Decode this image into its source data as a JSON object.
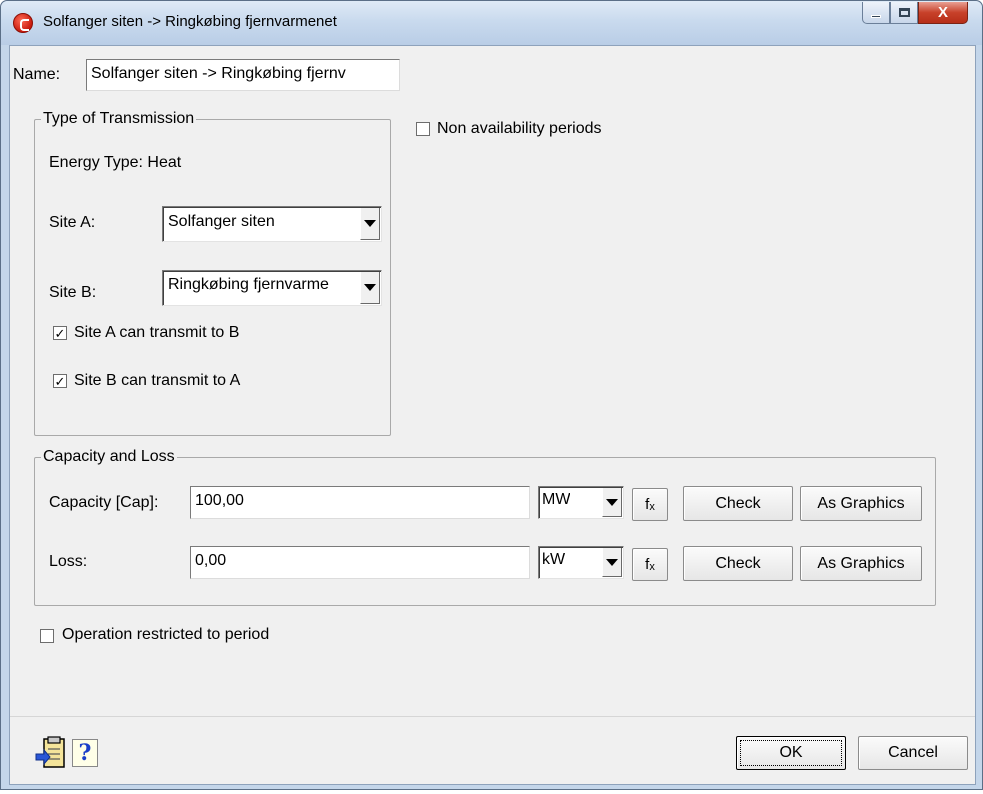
{
  "window": {
    "title": "Solfanger siten -> Ringkøbing fjernvarmenet",
    "controls": {
      "minimize": "minimize",
      "maximize": "maximize",
      "close": "X"
    }
  },
  "name": {
    "label": "Name:",
    "value": "Solfanger siten -> Ringkøbing fjernv"
  },
  "transmission": {
    "legend": "Type of Transmission",
    "energy_type": "Energy Type: Heat",
    "site_a_label": "Site A:",
    "site_a_value": "Solfanger siten",
    "site_b_label": "Site B:",
    "site_b_value": "Ringkøbing fjernvarme",
    "a_to_b_label": "Site A can transmit to B",
    "a_to_b_checked": true,
    "b_to_a_label": "Site B can transmit to A",
    "b_to_a_checked": true
  },
  "non_availability": {
    "label": "Non availability periods",
    "checked": false
  },
  "capacity_loss": {
    "legend": "Capacity and Loss",
    "capacity_label": "Capacity [Cap]:",
    "capacity_value": "100,00",
    "capacity_unit": "MW",
    "loss_label": "Loss:",
    "loss_value": "0,00",
    "loss_unit": "kW",
    "fx_label": "f",
    "fx_sub": "x",
    "check_label": "Check",
    "graphics_label": "As Graphics"
  },
  "operation_restricted": {
    "label": "Operation restricted to period",
    "checked": false
  },
  "footer": {
    "help_glyph": "?",
    "ok_label": "OK",
    "cancel_label": "Cancel"
  },
  "icons": {
    "app": "app-icon",
    "paste": "clipboard-paste-icon",
    "help": "help-icon"
  }
}
